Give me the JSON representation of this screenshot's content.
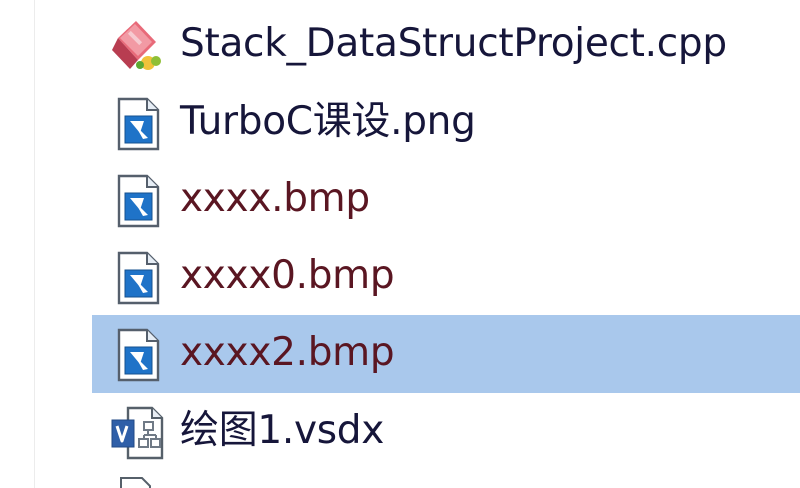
{
  "file_list": {
    "items": [
      {
        "name": "Stack_DataStructProject.cpp",
        "icon": "cpp-source-file-icon",
        "selected": false
      },
      {
        "name": "TurboC课设.png",
        "icon": "image-file-icon",
        "selected": false
      },
      {
        "name": "xxxx.bmp",
        "icon": "image-file-icon",
        "selected": false
      },
      {
        "name": "xxxx0.bmp",
        "icon": "image-file-icon",
        "selected": false
      },
      {
        "name": "xxxx2.bmp",
        "icon": "image-file-icon",
        "selected": true
      },
      {
        "name": "绘图1.vsdx",
        "icon": "visio-file-icon",
        "selected": false
      }
    ]
  },
  "colors": {
    "selection_background": "#a9c8ec",
    "text": "#16163a",
    "compressed_text": "#5a1622",
    "image_icon_blue": "#1f73c8",
    "visio_blue": "#2f5fa8"
  }
}
